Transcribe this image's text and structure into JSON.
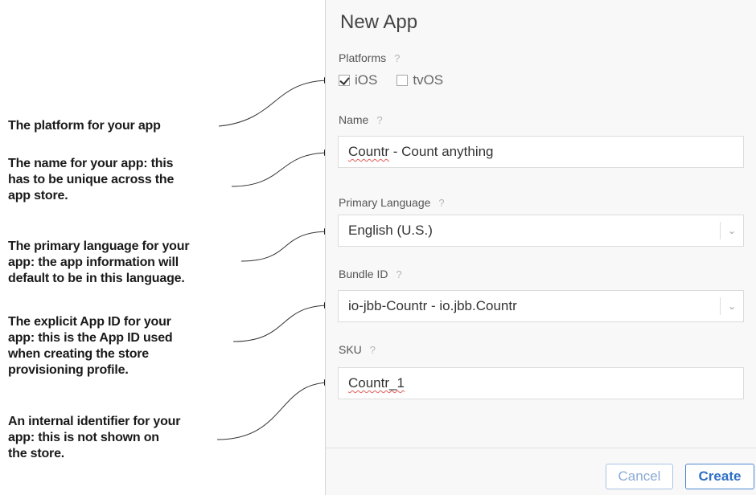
{
  "annotations": {
    "platform": [
      "The platform for your app"
    ],
    "name": [
      "The name for your app: this",
      "has to be unique across the",
      "app store."
    ],
    "language": [
      "The primary language for your",
      "app: the app information will",
      "default to be in this language."
    ],
    "bundle": [
      "The explicit App ID for your",
      "app: this is the App ID used",
      "when creating the store",
      "provisioning profile."
    ],
    "sku": [
      "An internal identifier for your",
      "app: this is not shown on",
      "the store."
    ]
  },
  "dialog": {
    "title": "New App",
    "help_mark": "?",
    "platforms": {
      "label": "Platforms",
      "options": [
        {
          "label": "iOS",
          "checked": true
        },
        {
          "label": "tvOS",
          "checked": false
        }
      ]
    },
    "name": {
      "label": "Name",
      "value_part1": "Countr",
      "value_part2": " - Count anything"
    },
    "language": {
      "label": "Primary Language",
      "value": "English (U.S.)"
    },
    "bundle": {
      "label": "Bundle ID",
      "value": "io-jbb-Countr - io.jbb.Countr"
    },
    "sku": {
      "label": "SKU",
      "value": "Countr_1"
    },
    "buttons": {
      "cancel": "Cancel",
      "create": "Create"
    }
  },
  "icons": {
    "chevron": "chevron-down-icon",
    "checkmark": "checkmark-icon",
    "arrow": "arrowhead-icon"
  }
}
